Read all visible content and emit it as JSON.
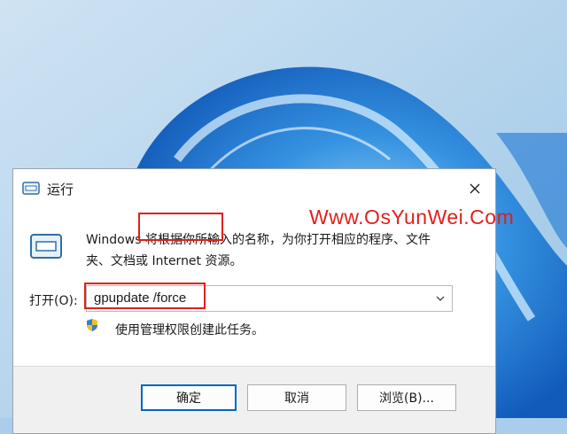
{
  "window": {
    "title": "运行",
    "close_glyph": "✕"
  },
  "content": {
    "description_line1": "Windows 将根据你所输入的名称，为你打开相应的程序、文件",
    "description_line2": "夹、文档或 Internet 资源。",
    "open_label": "打开(O):",
    "open_value": "gpupdate /force",
    "admin_note": "使用管理权限创建此任务。"
  },
  "buttons": {
    "ok": "确定",
    "cancel": "取消",
    "browse": "浏览(B)..."
  },
  "watermark": "Www.OsYunWei.Com",
  "icons": {
    "title": "run-app-icon",
    "main": "run-app-icon",
    "admin": "shield-icon",
    "dropdown": "chevron-down-icon",
    "close": "close-icon"
  },
  "colors": {
    "highlight": "#e0201c",
    "accent": "#0067c0"
  }
}
